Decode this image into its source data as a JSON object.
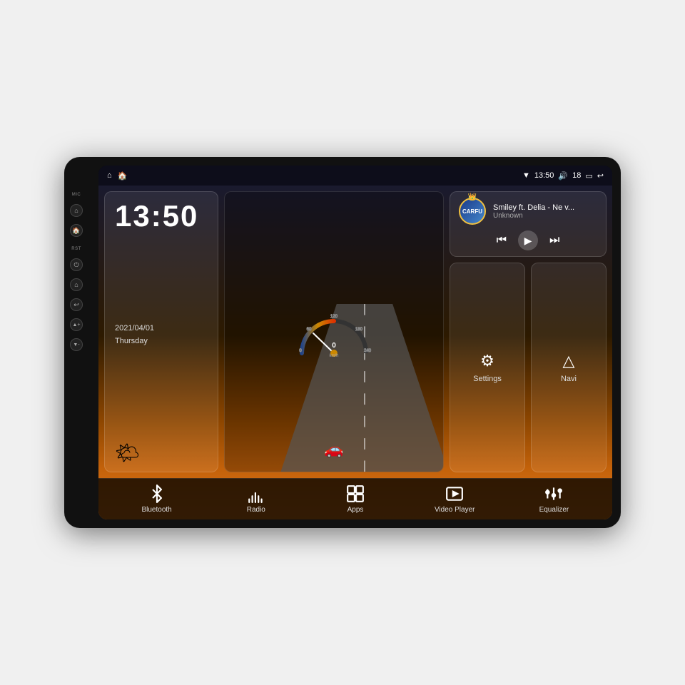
{
  "device": {
    "title": "Car Android Head Unit"
  },
  "status_bar": {
    "left_icons": [
      "⌂",
      "🏠"
    ],
    "time": "13:50",
    "volume_icon": "🔊",
    "volume_level": "18",
    "battery_icon": "🔋",
    "back_icon": "↩"
  },
  "side_buttons": {
    "mic_label": "MIC",
    "rst_label": "RST",
    "buttons": [
      "⏻",
      "⌂",
      "↩",
      "Vol+",
      "Vol-"
    ]
  },
  "clock": {
    "time": "13:50",
    "date": "2021/04/01",
    "day": "Thursday"
  },
  "speedometer": {
    "speed": "0",
    "unit": "km/h",
    "max": "240"
  },
  "music": {
    "logo_text": "CARFU",
    "title": "Smiley ft. Delia - Ne v...",
    "artist": "Unknown",
    "prev_label": "⏮",
    "play_label": "▶",
    "next_label": "⏭"
  },
  "shortcuts": [
    {
      "icon": "⚙",
      "label": "Settings"
    },
    {
      "icon": "🗺",
      "label": "Navi"
    }
  ],
  "bottom_bar": [
    {
      "icon": "bluetooth",
      "label": "Bluetooth"
    },
    {
      "icon": "radio",
      "label": "Radio"
    },
    {
      "icon": "apps",
      "label": "Apps"
    },
    {
      "icon": "video",
      "label": "Video Player"
    },
    {
      "icon": "equalizer",
      "label": "Equalizer"
    }
  ]
}
